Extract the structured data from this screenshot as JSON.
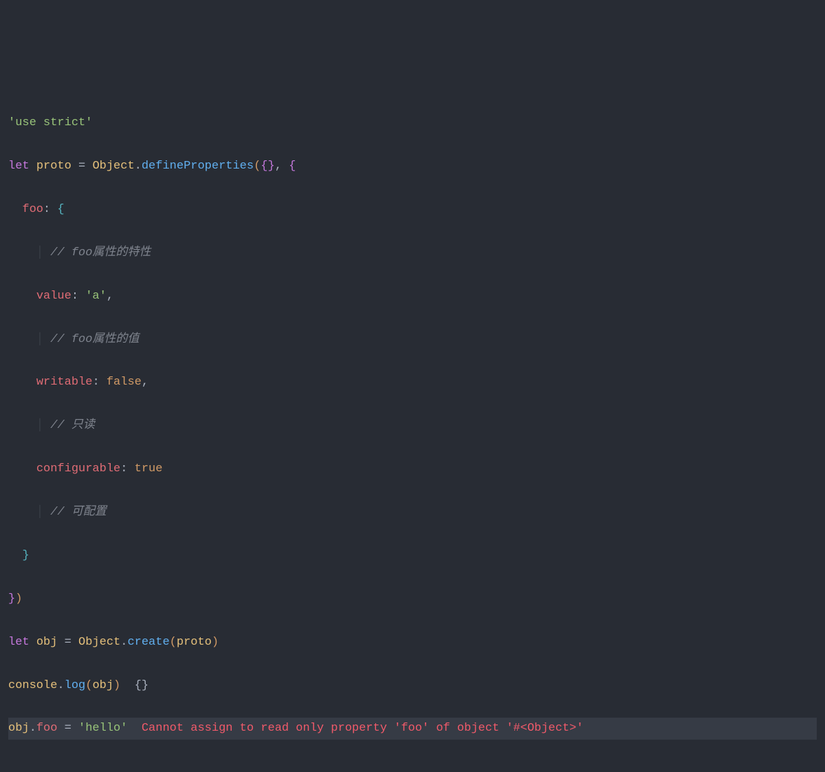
{
  "code": {
    "l1": {
      "use_strict": "'use strict'"
    },
    "l2": {
      "let": "let",
      "proto": "proto",
      "eq": " = ",
      "Object": "Object",
      "dot": ".",
      "defineProperties": "defineProperties",
      "lp": "(",
      "empty": "{}",
      "comma": ", ",
      "lb": "{"
    },
    "l3": {
      "indent": "  ",
      "foo": "foo",
      "colon": ": ",
      "lb": "{"
    },
    "l4": {
      "indent": "    ",
      "bar": "│ ",
      "comment": "// foo属性的特性"
    },
    "l5": {
      "indent": "    ",
      "value": "value",
      "colon": ": ",
      "a": "'a'",
      "comma": ","
    },
    "l6": {
      "indent": "    ",
      "bar": "│ ",
      "comment": "// foo属性的值"
    },
    "l7": {
      "indent": "    ",
      "writable": "writable",
      "colon": ": ",
      "false": "false",
      "comma": ","
    },
    "l8": {
      "indent": "    ",
      "bar": "│ ",
      "comment": "// 只读"
    },
    "l9": {
      "indent": "    ",
      "configurable": "configurable",
      "colon": ": ",
      "true": "true"
    },
    "l10": {
      "indent": "    ",
      "bar": "│ ",
      "comment": "// 可配置"
    },
    "l11": {
      "indent": "  ",
      "rb": "}"
    },
    "l12": {
      "rb": "}",
      "rp": ")"
    },
    "l13": {
      "let": "let",
      "obj": "obj",
      "eq": " = ",
      "Object": "Object",
      "dot": ".",
      "create": "create",
      "lp": "(",
      "proto": "proto",
      "rp": ")"
    },
    "l14": {
      "console": "console",
      "dot": ".",
      "log": "log",
      "lp": "(",
      "obj": "obj",
      "rp": ")",
      "out": "  {}"
    },
    "l15": {
      "obj": "obj",
      "dot": ".",
      "foo": "foo",
      "eq": " = ",
      "hello": "'hello'",
      "err": "  Cannot assign to read only property 'foo' of object '#<Object>'"
    }
  }
}
